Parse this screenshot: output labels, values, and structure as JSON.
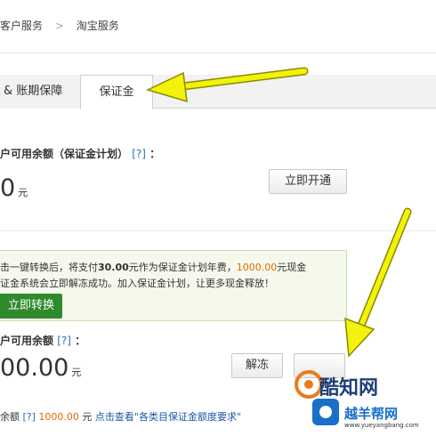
{
  "breadcrumb": {
    "items": [
      "客户服务",
      "淘宝服务"
    ],
    "separator": ">"
  },
  "tabs": [
    {
      "label": "& 账期保障",
      "active": false
    },
    {
      "label": "保证金",
      "active": true
    }
  ],
  "available_balance": {
    "label": "户可用余额（保证金计划）",
    "help": "[?]",
    "suffix": "：",
    "amount": "0",
    "unit": "元",
    "button": "立即开通"
  },
  "notice": {
    "line1_a": "击一键转换后，将支付",
    "line1_amount": "30.00",
    "line1_b": "元作为保证金计划年费，",
    "line1_amount2": "1000.00",
    "line1_c": "元现金",
    "line2": "证金系统会立即解冻成功。加入保证金计划，让更多现金释放！",
    "button": "立即转换"
  },
  "cash_balance": {
    "label": "户可用余额",
    "help": "[?]",
    "suffix": "：",
    "amount": "00.00",
    "unit": "元",
    "unfreeze_button": "解冻",
    "second_button": ""
  },
  "bottom": {
    "prefix": "余额",
    "help": "[?]",
    "amount": "1000.00",
    "unit": "元",
    "link": "点击查看\"各类目保证金额度要求\""
  },
  "watermark": {
    "title": "酷知网",
    "subtitle": "越羊帮网",
    "url": "www.yueyangbang.com"
  },
  "colors": {
    "accent_green": "#2f8a2b",
    "orange": "#e06a00",
    "link_blue": "#1d57a6",
    "arrow_yellow": "#f2f20a"
  }
}
